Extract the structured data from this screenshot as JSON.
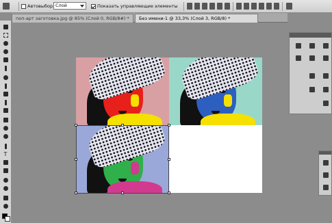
{
  "options_bar": {
    "auto_select_label": "Автовыбор:",
    "auto_select_checked": false,
    "auto_select_value": "Слой",
    "show_controls_label": "Показать управляющие элементы",
    "show_controls_checked": true
  },
  "tabs": [
    {
      "label": "поп-арт заготовка.jpg @ 85% (Слой 0, RGB/8#) *",
      "active": false
    },
    {
      "label": "Без имени-1 @ 33,3% (Слой 3, RGB/8) *",
      "active": true
    }
  ],
  "tools": [
    "move-tool",
    "marquee-tool",
    "lasso-tool",
    "quick-select-tool",
    "crop-tool",
    "eyedropper-tool",
    "healing-tool",
    "brush-tool",
    "stamp-tool",
    "history-brush-tool",
    "eraser-tool",
    "gradient-tool",
    "blur-tool",
    "dodge-tool",
    "pen-tool",
    "type-tool",
    "path-select-tool",
    "shape-tool",
    "3d-rotate-tool",
    "3d-orbit-tool",
    "hand-tool",
    "zoom-tool"
  ],
  "colors": {
    "quadrant_1_bg": "#d9a0a4",
    "quadrant_2_bg": "#99d8c8",
    "quadrant_3_bg": "#9aa8d9",
    "quadrant_4_bg": "#ffffff",
    "face_1": "#e8201c",
    "face_2": "#2d5fc0",
    "face_3": "#2fb04a",
    "accent_1": "#f6e000",
    "accent_2": "#f6e000",
    "accent_3": "#d13a8f"
  },
  "panel_icons": [
    "layers-icon",
    "channels-icon",
    "swatches-icon",
    "adjustments-icon",
    "character-icon",
    "paragraph-icon",
    "histogram-icon",
    "navigator-icon",
    "info-icon",
    "masks-icon",
    "3d-icon",
    "styles-icon",
    "brushes-icon"
  ]
}
